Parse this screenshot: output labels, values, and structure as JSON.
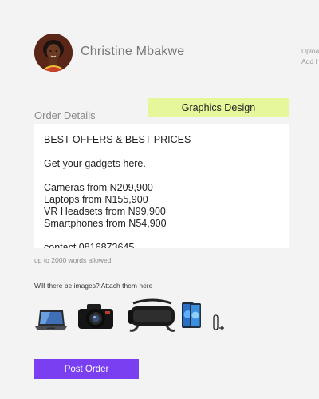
{
  "profile": {
    "name": "Christine Mbakwe",
    "avatar_icon": "user-avatar-photo"
  },
  "side_hint": {
    "line1": "Uploa",
    "line2": "Add I"
  },
  "order": {
    "label": "Order Details",
    "category": "Graphics Design",
    "text": "BEST OFFERS & BEST PRICES\n\nGet your gadgets here.\n\nCameras from N209,900\nLaptops from N155,900\nVR Headsets from N99,900\nSmartphones from N54,900\n\ncontact 0816873645",
    "word_limit_hint": "up to 2000 words allowed"
  },
  "images": {
    "label": "Will there be images? Attach them here",
    "thumbnails": [
      "laptop-icon",
      "camera-icon",
      "vr-headset-icon",
      "smartphone-icon"
    ],
    "attach_icon": "paperclip-add-icon"
  },
  "actions": {
    "post_label": "Post Order",
    "post_color": "#7b3ff2"
  },
  "colors": {
    "chip_bg": "#e6f79b",
    "page_bg": "#f3f3f3"
  }
}
